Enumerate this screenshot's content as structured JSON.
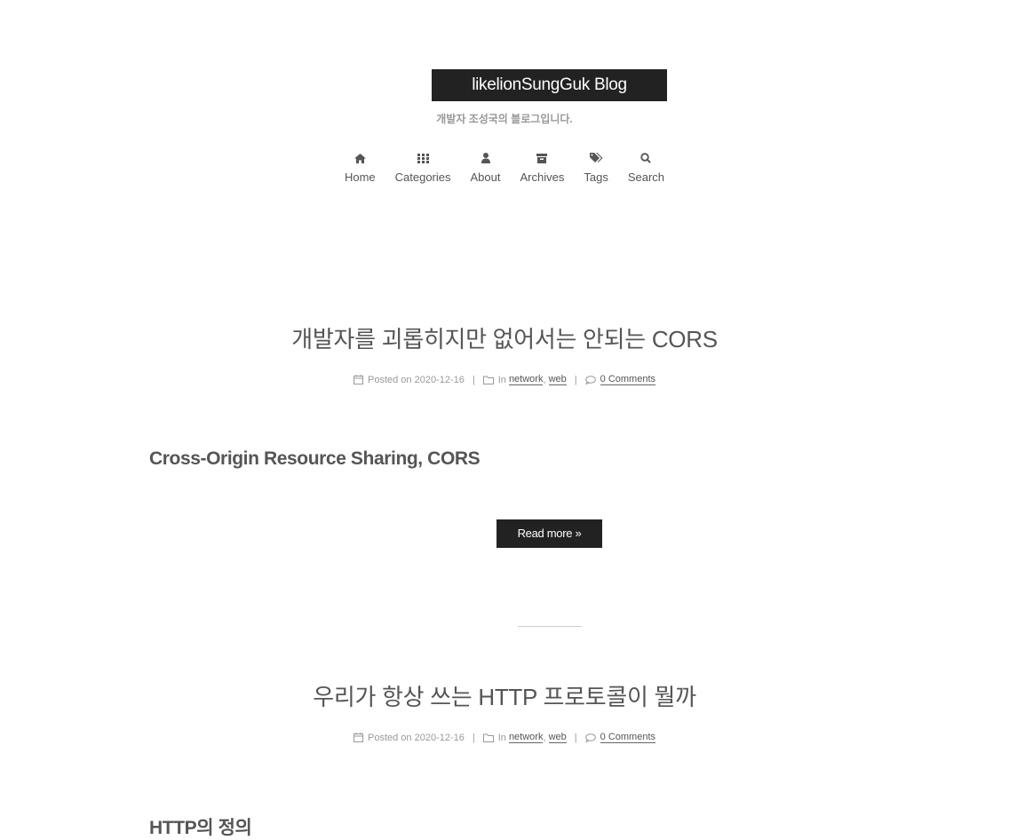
{
  "header": {
    "brand": "likelionSungGuk Blog",
    "subtitle": "개발자 조성국의 블로그입니다."
  },
  "nav": {
    "items": [
      {
        "label": "Home",
        "icon": "home-icon"
      },
      {
        "label": "Categories",
        "icon": "th-icon"
      },
      {
        "label": "About",
        "icon": "user-icon"
      },
      {
        "label": "Archives",
        "icon": "archive-icon"
      },
      {
        "label": "Tags",
        "icon": "tags-icon"
      },
      {
        "label": "Search",
        "icon": "search-icon"
      }
    ]
  },
  "posts": [
    {
      "title": "개발자를 괴롭히지만 없어서는 안되는 CORS",
      "posted_prefix": "Posted on",
      "date": "2020-12-16",
      "in_label": "In",
      "categories": [
        "network",
        "web"
      ],
      "comments": "0 Comments",
      "excerpt_heading": "Cross-Origin Resource Sharing, CORS",
      "read_more": "Read more »"
    },
    {
      "title": "우리가 항상 쓰는 HTTP 프로토콜이 뭘까",
      "posted_prefix": "Posted on",
      "date": "2020-12-16",
      "in_label": "In",
      "categories": [
        "network",
        "web"
      ],
      "comments": "0 Comments",
      "excerpt_heading": "HTTP의 정의"
    }
  ]
}
